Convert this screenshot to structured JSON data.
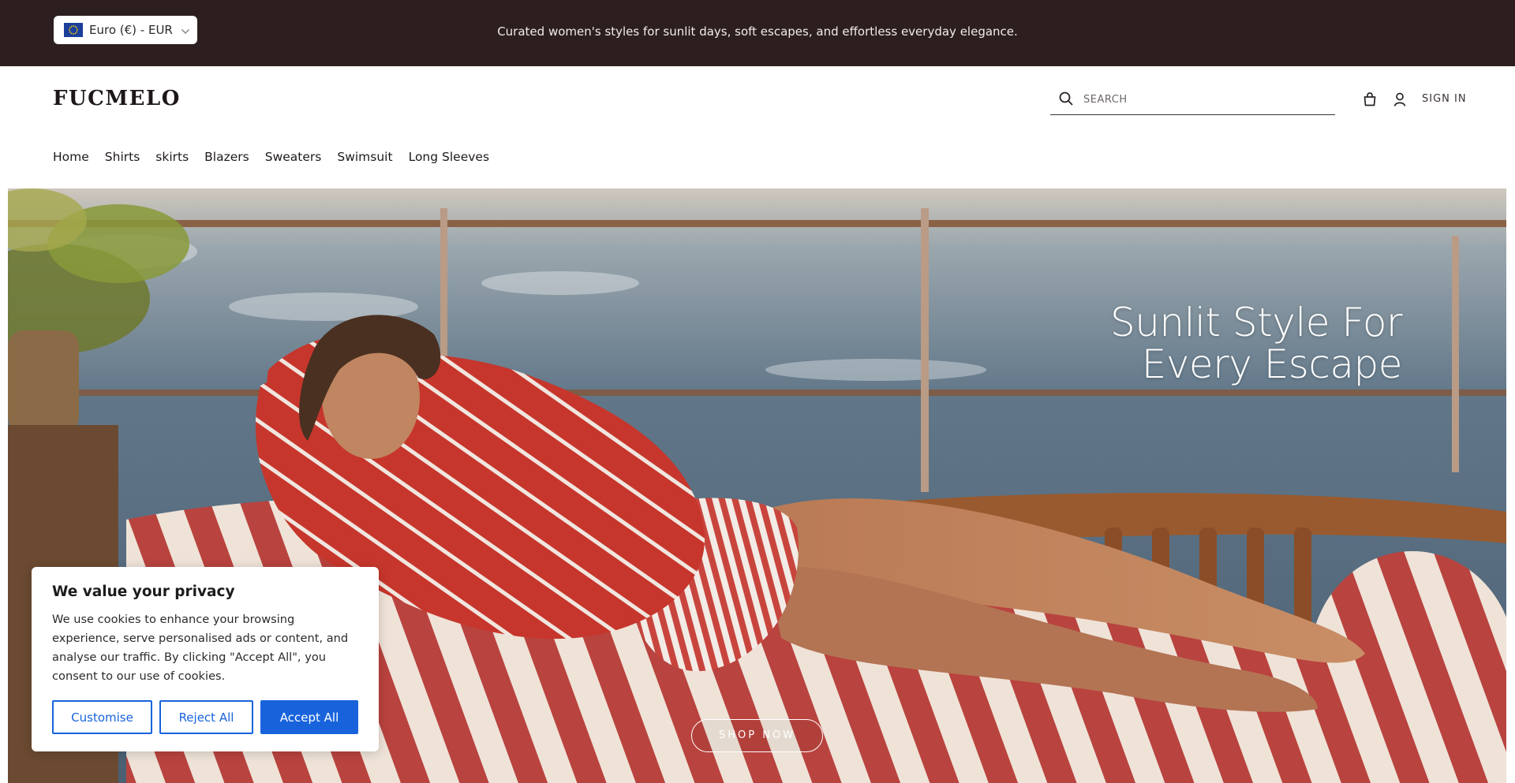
{
  "announcement": {
    "currency_label": "Euro (€) - EUR",
    "text": "Curated women's styles for sunlit days, soft escapes, and effortless everyday elegance."
  },
  "header": {
    "logo": "FUCMELO",
    "search_placeholder": "SEARCH",
    "signin_label": "SIGN IN"
  },
  "nav": {
    "items": [
      {
        "label": "Home"
      },
      {
        "label": "Shirts"
      },
      {
        "label": "skirts"
      },
      {
        "label": "Blazers"
      },
      {
        "label": "Sweaters"
      },
      {
        "label": "Swimsuit"
      },
      {
        "label": "Long Sleeves"
      }
    ]
  },
  "hero": {
    "title_line1": "Sunlit Style For",
    "title_line2": "Every Escape",
    "cta_label": "SHOP NOW"
  },
  "cookie": {
    "title": "We value your privacy",
    "text": "We use cookies to enhance your browsing experience, serve personalised ads or content, and analyse our traffic. By clicking \"Accept All\", you consent to our use of cookies.",
    "customise_label": "Customise",
    "reject_label": "Reject All",
    "accept_label": "Accept All"
  },
  "colors": {
    "announcement_bg": "#2d1f1f",
    "accent_blue": "#1863dc",
    "stripe_red": "#c6362c"
  },
  "icons": [
    "eu-flag-icon",
    "chevron-down-icon",
    "search-icon",
    "cart-icon",
    "user-icon"
  ]
}
